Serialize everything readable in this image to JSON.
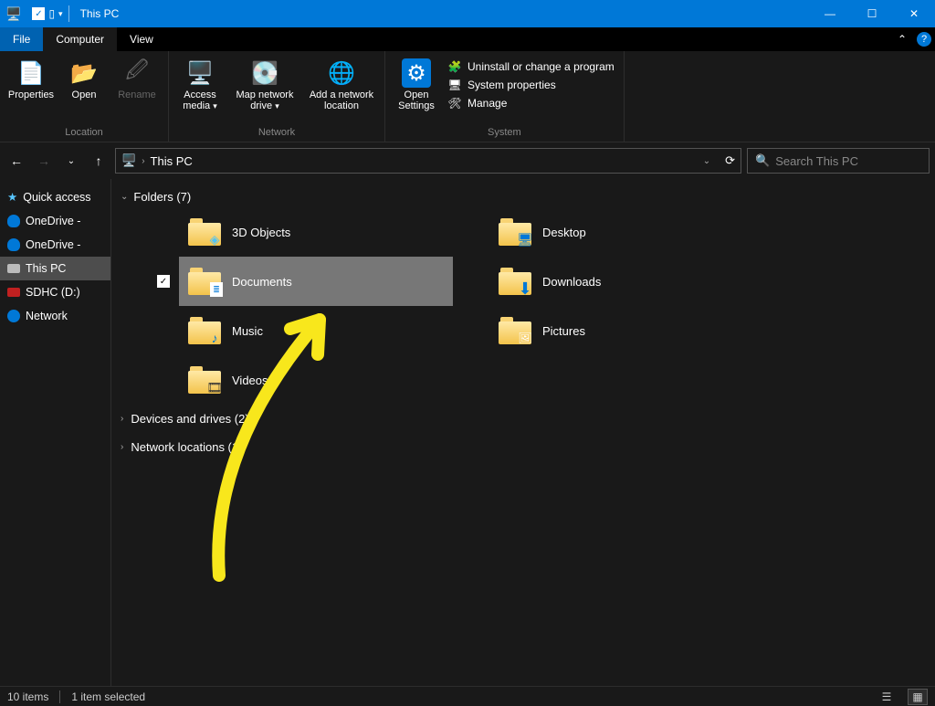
{
  "titlebar": {
    "title": "This PC"
  },
  "menubar": {
    "file": "File",
    "computer": "Computer",
    "view": "View"
  },
  "ribbon": {
    "location": {
      "label": "Location",
      "properties": "Properties",
      "open": "Open",
      "rename": "Rename"
    },
    "network": {
      "label": "Network",
      "access_media": "Access media",
      "map_drive": "Map network drive",
      "add_location": "Add a network location"
    },
    "system": {
      "label": "System",
      "open_settings": "Open Settings",
      "uninstall": "Uninstall or change a program",
      "sys_props": "System properties",
      "manage": "Manage"
    }
  },
  "address": {
    "crumb": "This PC"
  },
  "search": {
    "placeholder": "Search This PC"
  },
  "sidebar": {
    "items": [
      {
        "label": "Quick access"
      },
      {
        "label": "OneDrive -"
      },
      {
        "label": "OneDrive -"
      },
      {
        "label": "This PC"
      },
      {
        "label": "SDHC (D:)"
      },
      {
        "label": "Network"
      }
    ]
  },
  "content": {
    "folders_header": "Folders (7)",
    "left_col": [
      {
        "label": "3D Objects",
        "overlay": "cube"
      },
      {
        "label": "Documents",
        "overlay": "doc",
        "selected": true
      },
      {
        "label": "Music",
        "overlay": "music"
      },
      {
        "label": "Videos",
        "overlay": "video"
      }
    ],
    "right_col": [
      {
        "label": "Desktop",
        "overlay": "desk"
      },
      {
        "label": "Downloads",
        "overlay": "down"
      },
      {
        "label": "Pictures",
        "overlay": "pic"
      }
    ],
    "devices_header": "Devices and drives (2)",
    "network_header": "Network locations (1)"
  },
  "status": {
    "count": "10 items",
    "selected": "1 item selected"
  }
}
